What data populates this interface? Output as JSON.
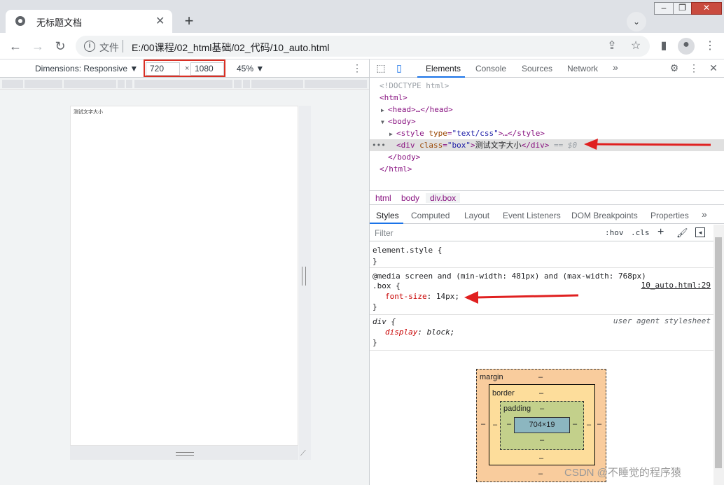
{
  "browser": {
    "tab_title": "无标题文档",
    "tab_close": "✕",
    "new_tab": "+",
    "tab_search": "⌄",
    "window_buttons": {
      "minimize": "▭",
      "restore": "❐",
      "close": "✕"
    },
    "toolbar": {
      "back": "←",
      "forward": "→",
      "reload": "↻",
      "file_label": "文件",
      "url": "E:/00课程/02_html基础/02_代码/10_auto.html",
      "share": "⇪",
      "bookmark": "☆",
      "sidebar": "▮",
      "profile": "●",
      "menu": "⋮"
    }
  },
  "device_toolbar": {
    "dimensions_label": "Dimensions: Responsive ▼",
    "width": "720",
    "x_sep": "×",
    "height": "1080",
    "zoom": "45% ▼",
    "more": "⋮"
  },
  "page_preview": {
    "text": "测试文字大小"
  },
  "devtools": {
    "tabs": [
      "Elements",
      "Console",
      "Sources",
      "Network"
    ],
    "more_tabs": "»",
    "dom": {
      "doctype": "<!DOCTYPE html>",
      "html_open": "<html>",
      "head": "<head>…</head>",
      "body_open": "<body>",
      "style_line": {
        "tag": "<style ",
        "attr": "type",
        "val": "\"text/css\"",
        "rest": ">…</style>"
      },
      "div_line": {
        "tag": "<div ",
        "attr": "class",
        "val": "\"box\"",
        "text": "测试文字大小",
        "close": "</div>",
        "eq": "== $0"
      },
      "body_close": "</body>",
      "html_close": "</html>",
      "dots": "•••"
    },
    "breadcrumbs": [
      "html",
      "body",
      "div.box"
    ],
    "style_tabs": [
      "Styles",
      "Computed",
      "Layout",
      "Event Listeners",
      "DOM Breakpoints",
      "Properties"
    ],
    "filter_placeholder": "Filter",
    "filter_buttons": {
      "hov": ":hov",
      "cls": ".cls",
      "add": "+"
    },
    "rules": {
      "element_style": {
        "selector": "element.style {",
        "close": "}"
      },
      "media_rule": {
        "media": "@media screen and (min-width: 481px) and (max-width: 768px)",
        "selector": ".box {",
        "source": "10_auto.html:29",
        "prop": "font-size",
        "value": "14px;",
        "close": "}"
      },
      "ua_rule": {
        "selector": "div {",
        "source": "user agent stylesheet",
        "prop": "display",
        "value": "block;",
        "close": "}"
      }
    },
    "box_model": {
      "margin_label": "margin",
      "border_label": "border",
      "padding_label": "padding",
      "content": "704×19",
      "dash": "–"
    }
  },
  "watermark": "CSDN @不睡觉的程序猿",
  "colors": {
    "accent": "#1a73e8",
    "annotation_arrow": "#e02020",
    "highlight_box": "#d93025"
  }
}
